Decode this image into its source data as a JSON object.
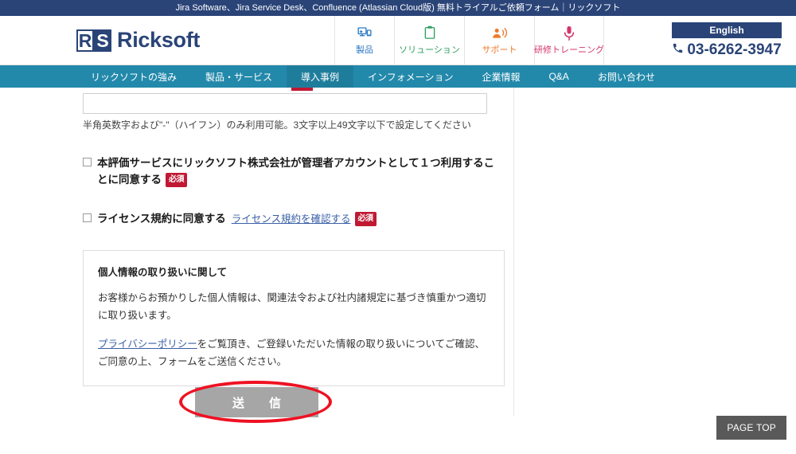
{
  "topbar": {
    "title": "Jira Software、Jira Service Desk、Confluence (Atlassian Cloud版) 無料トライアルご依頼フォーム｜リックソフト"
  },
  "header": {
    "logo": {
      "mark_r": "R",
      "mark_s": "S",
      "word": "Ricksoft"
    },
    "nav": [
      {
        "label": "製品",
        "icon": "monitor-icon",
        "color": "#2b78c4"
      },
      {
        "label": "ソリューション",
        "icon": "clipboard-icon",
        "color": "#2f9e5e"
      },
      {
        "label": "サポート",
        "icon": "support-person-icon",
        "color": "#ec7b2b"
      },
      {
        "label": "研修トレーニング",
        "icon": "microphone-icon",
        "color": "#d6356c"
      }
    ],
    "english_button": "English",
    "phone_icon": "phone-icon",
    "phone": "03-6262-3947"
  },
  "mainnav": {
    "items": [
      {
        "label": "リックソフトの強み",
        "active": false
      },
      {
        "label": "製品・サービス",
        "active": false
      },
      {
        "label": "導入事例",
        "active": true
      },
      {
        "label": "インフォメーション",
        "active": false
      },
      {
        "label": "企業情報",
        "active": false
      },
      {
        "label": "Q&A",
        "active": false
      },
      {
        "label": "お問い合わせ",
        "active": false
      }
    ]
  },
  "form": {
    "input_value": "",
    "input_placeholder": "",
    "hint": "半角英数字および\"-\"（ハイフン）のみ利用可能。3文字以上49文字以下で設定してください",
    "checkbox_1": {
      "label": "本評価サービスにリックソフト株式会社が管理者アカウントとして１つ利用することに同意する",
      "badge": "必須",
      "checked": false
    },
    "checkbox_2": {
      "label": "ライセンス規約に同意する",
      "link": "ライセンス規約を確認する",
      "badge": "必須",
      "checked": false
    },
    "privacy": {
      "title": "個人情報の取り扱いに関して",
      "paragraph_1": "お客様からお預かりした個人情報は、関連法令および社内諸規定に基づき慎重かつ適切に取り扱います。",
      "link": "プライバシーポリシー",
      "paragraph_2_rest": "をご覧頂き、ご登録いただいた情報の取り扱いについてご確認、ご同意の上、フォームをご送信ください。"
    },
    "submit_label": "送　信"
  },
  "footer": {
    "page_top": "PAGE TOP"
  },
  "colors": {
    "topbar_navy": "#2a4478",
    "nav_teal": "#2389ab",
    "nav_teal_active": "#1f7d9c",
    "badge_red": "#c01933",
    "annotation_red": "#ee1122",
    "submit_gray": "#a6a6a6",
    "pagetop_gray": "#595959",
    "link_blue": "#3a5fa8"
  }
}
